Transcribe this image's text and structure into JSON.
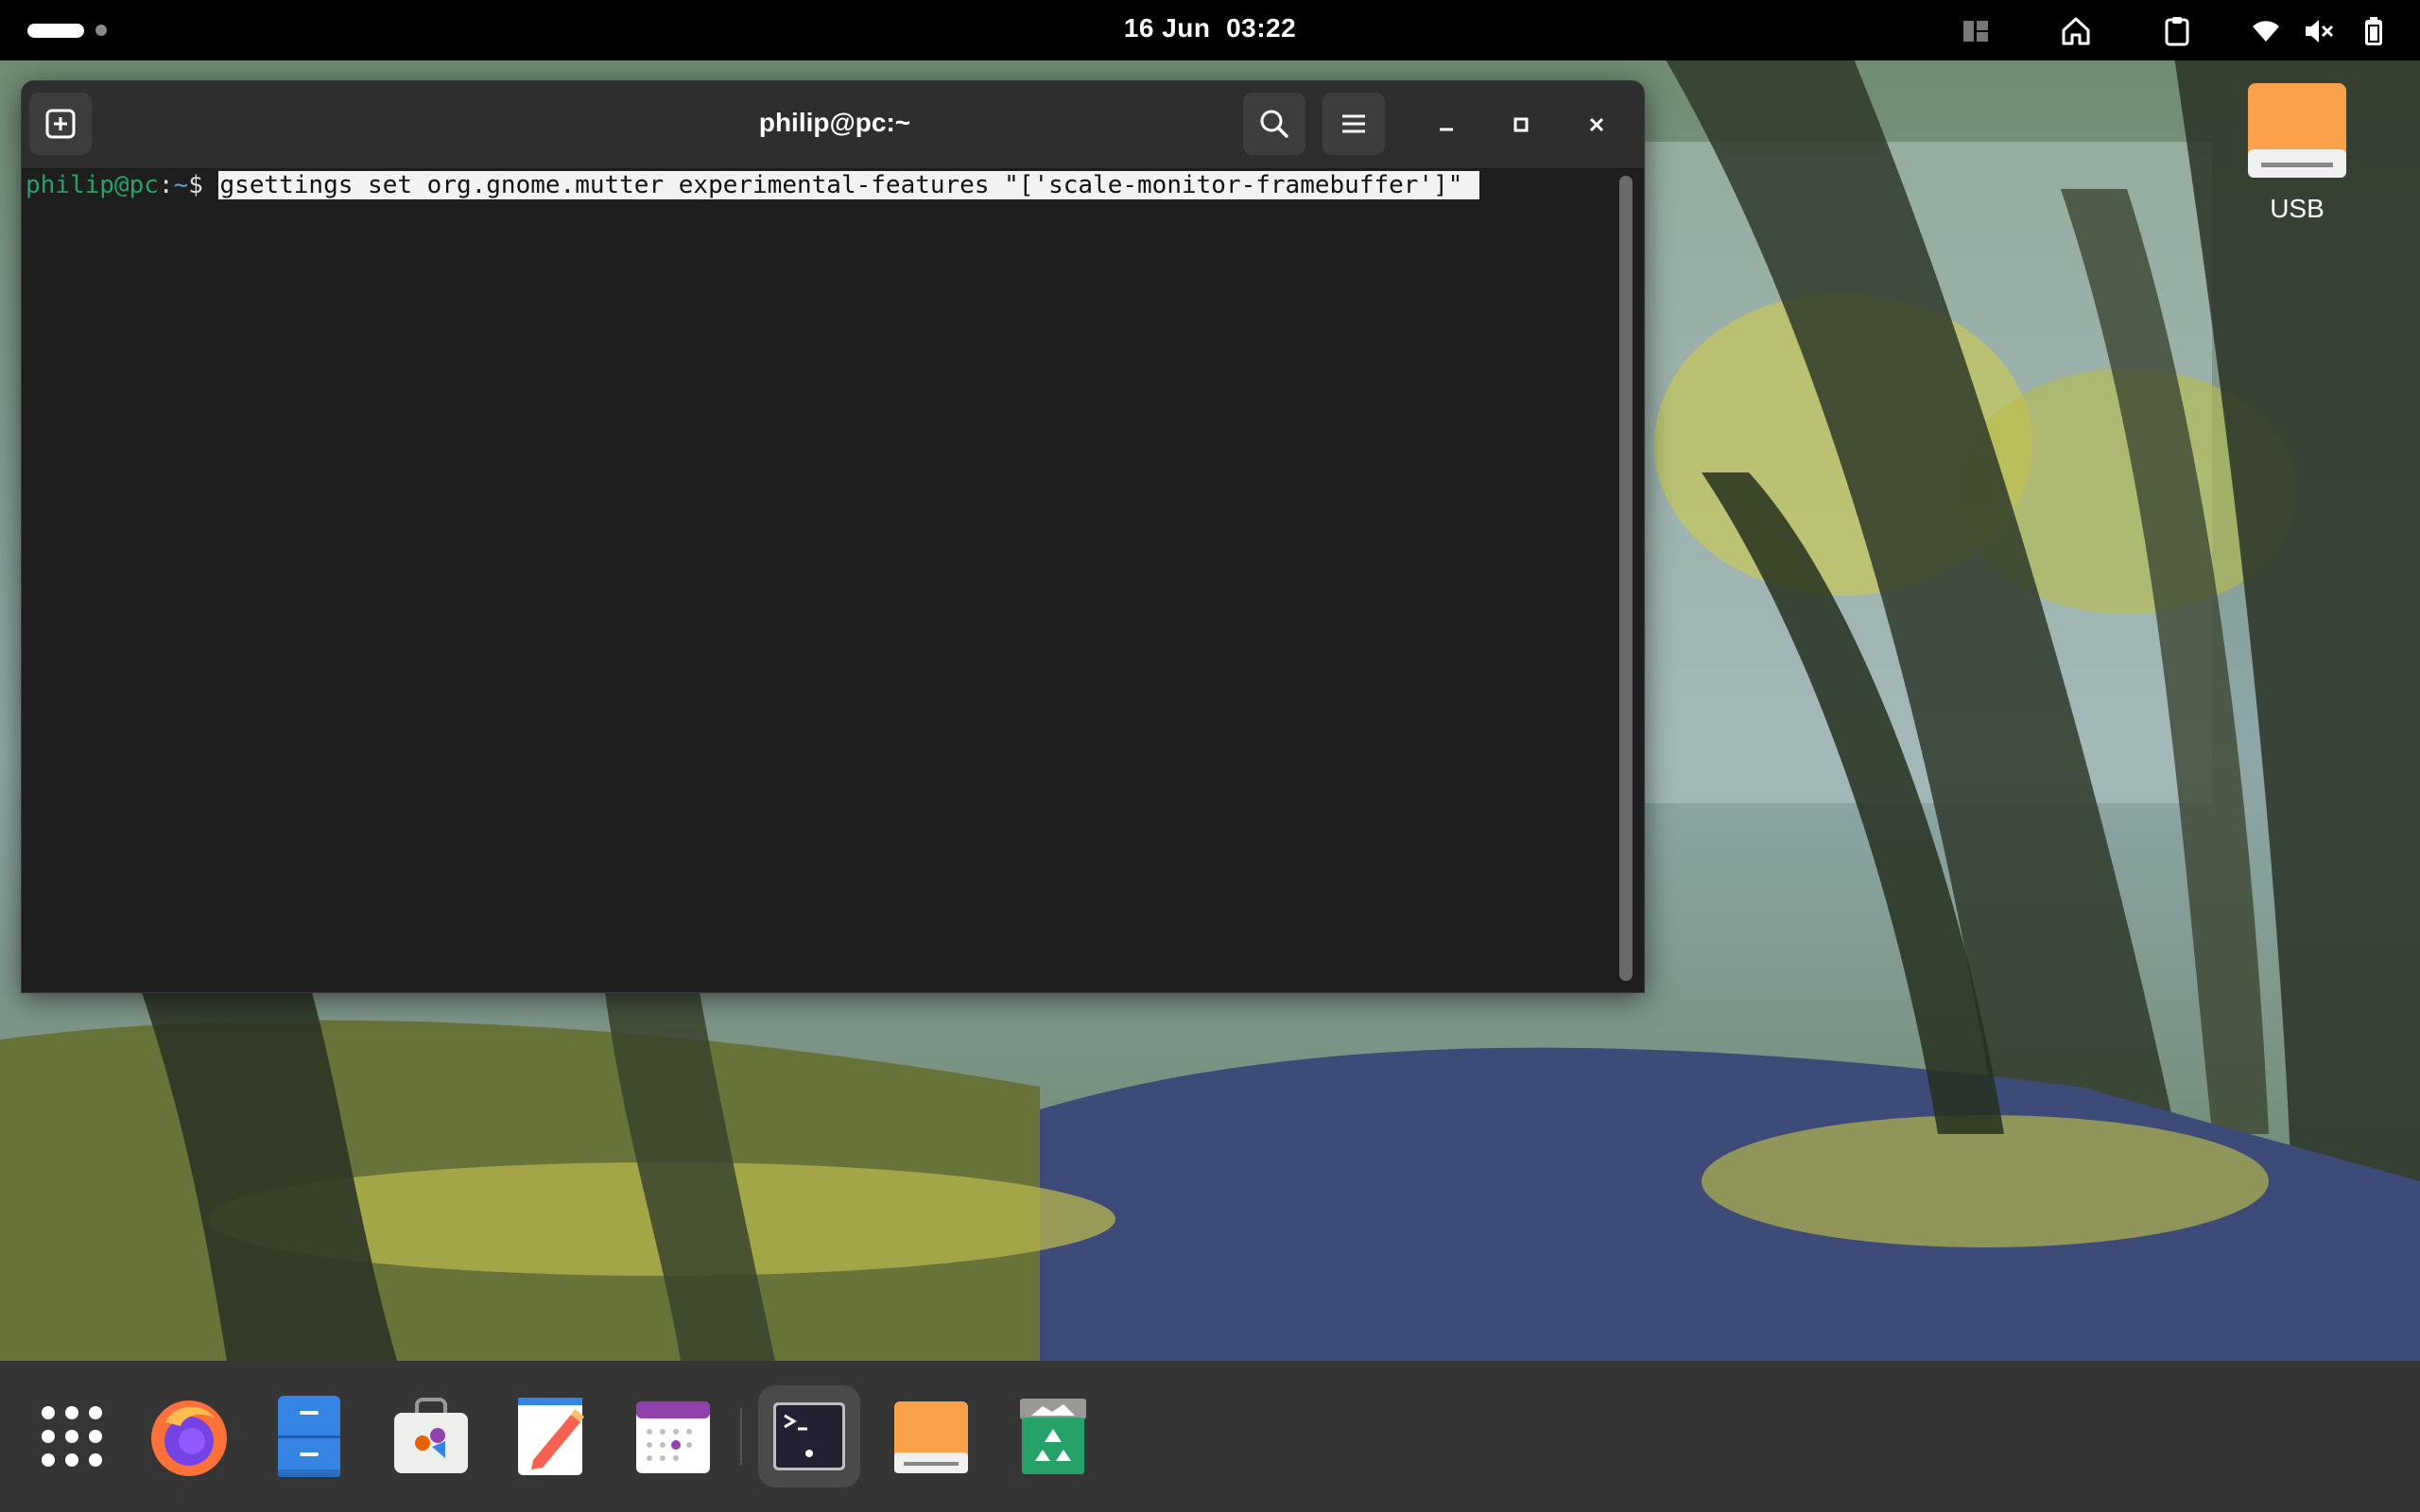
{
  "topbar": {
    "clock": "16 Jun  03:22",
    "tray_icons": [
      "workspace-grid-icon",
      "home-icon",
      "clipboard-icon",
      "wifi-icon",
      "volume-muted-icon",
      "battery-icon"
    ]
  },
  "terminal": {
    "title": "philip@pc:~",
    "prompt_user": "philip@pc",
    "prompt_colon": ":",
    "prompt_path": "~",
    "prompt_sign": "$ ",
    "command": "gsettings set org.gnome.mutter experimental-features \"['scale-monitor-framebuffer']\" "
  },
  "desktop": {
    "usb_label": "USB"
  },
  "dock": {
    "items": [
      "app-grid",
      "firefox",
      "files",
      "software",
      "text-editor",
      "calendar",
      "terminal",
      "usb-drive",
      "trash"
    ],
    "active": "terminal"
  },
  "colors": {
    "prompt_green": "#26a269",
    "prompt_blue": "#5b9bd5",
    "usb_orange": "#f9a04a"
  }
}
